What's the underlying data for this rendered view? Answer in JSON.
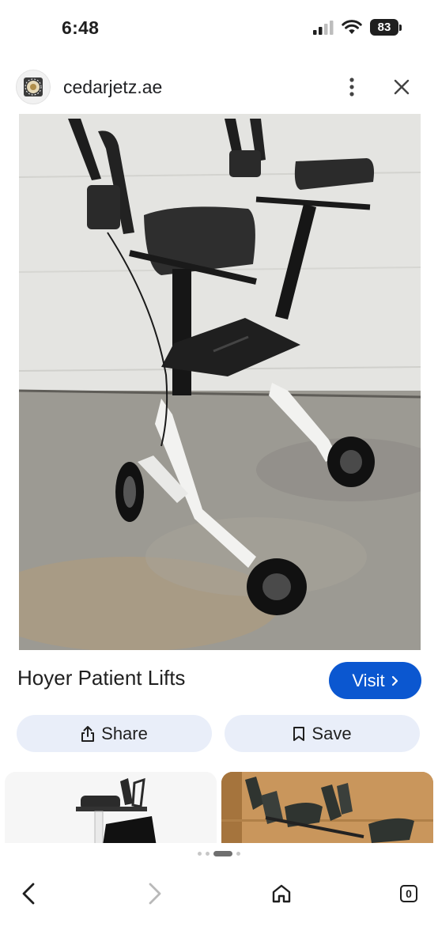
{
  "status_bar": {
    "time": "6:48",
    "battery_level": "83",
    "icons": [
      "cellular-signal-icon",
      "wifi-icon",
      "battery-icon"
    ]
  },
  "header": {
    "site_name": "cedarjetz.ae",
    "icons": [
      "site-favicon",
      "more-vert-icon",
      "close-icon"
    ]
  },
  "result": {
    "title": "Hoyer Patient Lifts",
    "visit_label": "Visit",
    "share_label": "Share",
    "save_label": "Save"
  },
  "related": {
    "thumbnail_count": 2
  },
  "pager": {
    "dots": 4,
    "active_index": 2
  },
  "bottom_nav": {
    "tab_count": "0",
    "icons": [
      "back-icon",
      "forward-icon",
      "home-icon",
      "tabs-icon"
    ]
  },
  "colors": {
    "accent": "#0b57d0",
    "button_bg": "#e9eef9",
    "text": "#1f1f1f"
  }
}
